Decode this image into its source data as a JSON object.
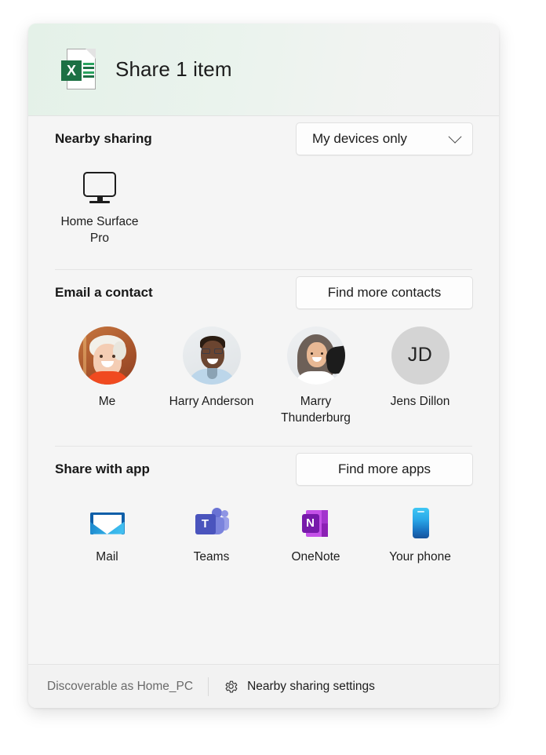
{
  "window": {
    "header": {
      "title": "Share 1 item",
      "file_icon": "excel-file-icon",
      "excel_letter": "X",
      "accent_color": "#1d7044",
      "background_tint": "#e4f1e8"
    }
  },
  "nearby_sharing": {
    "title": "Nearby sharing",
    "dropdown_value": "My devices only",
    "devices": [
      {
        "name": "Home Surface\nPro",
        "icon": "monitor-icon"
      }
    ]
  },
  "email_contact": {
    "title": "Email a contact",
    "button_label": "Find more contacts",
    "contacts": [
      {
        "name": "Me",
        "avatar_type": "photo"
      },
      {
        "name": "Harry Anderson",
        "avatar_type": "photo"
      },
      {
        "name": "Marry\nThunderburg",
        "avatar_type": "photo"
      },
      {
        "name": "Jens Dillon",
        "avatar_type": "initials",
        "initials": "JD"
      }
    ]
  },
  "share_with_app": {
    "title": "Share with app",
    "button_label": "Find more apps",
    "apps": [
      {
        "name": "Mail",
        "icon": "mail-icon",
        "color": "#2aa7e0"
      },
      {
        "name": "Teams",
        "icon": "teams-icon",
        "color": "#4a54bd",
        "letter": "T"
      },
      {
        "name": "OneNote",
        "icon": "onenote-icon",
        "color": "#7719aa",
        "letter": "N"
      },
      {
        "name": "Your phone",
        "icon": "phone-icon",
        "color": "#2aa8e8"
      }
    ]
  },
  "footer": {
    "discoverable_text": "Discoverable as Home_PC",
    "settings_link": "Nearby sharing settings",
    "settings_icon": "gear-icon"
  }
}
